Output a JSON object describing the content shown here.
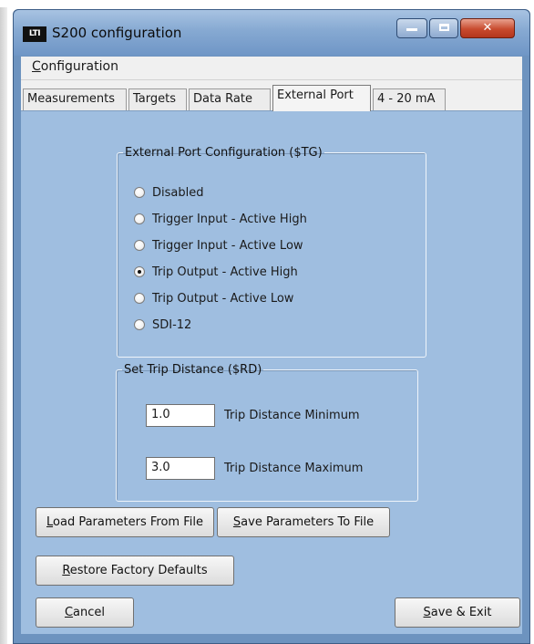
{
  "window": {
    "logo_text": "LTI",
    "title": "S200 configuration",
    "minimize_symbol": "",
    "close_symbol": "✕"
  },
  "menu": {
    "configuration_first": "C",
    "configuration_rest": "onfiguration"
  },
  "tabs": [
    {
      "label": "Measurements",
      "active": false
    },
    {
      "label": "Targets",
      "active": false
    },
    {
      "label": "Data Rate",
      "active": false
    },
    {
      "label": "External Port",
      "active": true
    },
    {
      "label": "4 - 20 mA",
      "active": false
    }
  ],
  "external_port": {
    "legend": "External Port Configuration  ($TG)",
    "options": [
      {
        "label": "Disabled",
        "checked": false
      },
      {
        "label": "Trigger Input - Active High",
        "checked": false
      },
      {
        "label": "Trigger Input - Active Low",
        "checked": false
      },
      {
        "label": "Trip Output - Active High",
        "checked": true
      },
      {
        "label": "Trip Output - Active Low",
        "checked": false
      },
      {
        "label": "SDI-12",
        "checked": false
      }
    ]
  },
  "trip_distance": {
    "legend": "Set Trip Distance ($RD)",
    "minimum_value": "1.0",
    "minimum_label": "Trip Distance Minimum",
    "maximum_value": "3.0",
    "maximum_label": "Trip Distance Maximum"
  },
  "buttons": {
    "load": {
      "mnemonic": "L",
      "rest": "oad Parameters From File"
    },
    "save_params": {
      "mnemonic": "S",
      "rest": "ave Parameters To File"
    },
    "restore": {
      "mnemonic": "R",
      "rest": "estore Factory Defaults"
    },
    "cancel": {
      "mnemonic": "C",
      "rest": "ancel"
    },
    "save_exit": {
      "mnemonic": "S",
      "rest": "ave & Exit"
    }
  },
  "colors": {
    "titlebar": "#86a9d2",
    "panel_background": "#9fbee0",
    "close_button": "#c84a2e"
  }
}
